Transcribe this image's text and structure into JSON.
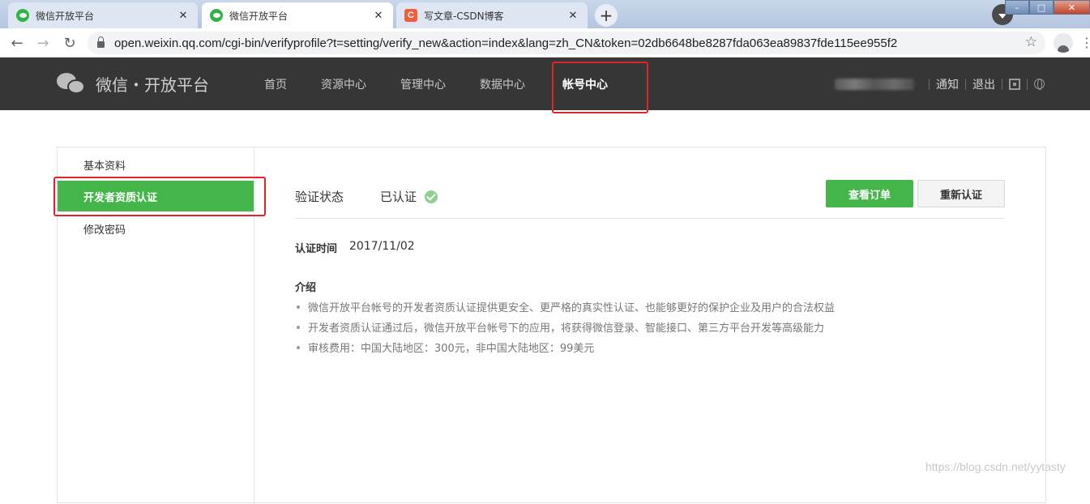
{
  "browser": {
    "tabs": [
      {
        "title": "微信开放平台",
        "icon": "wechat-icon",
        "state": "inactive"
      },
      {
        "title": "微信开放平台",
        "icon": "wechat-icon",
        "state": "active"
      },
      {
        "title": "写文章-CSDN博客",
        "icon": "csdn-icon",
        "state": "inactive",
        "icon_letter": "C"
      }
    ],
    "close_glyph": "✕",
    "new_tab_glyph": "+",
    "url": "open.weixin.qq.com/cgi-bin/verifyprofile?t=setting/verify_new&action=index&lang=zh_CN&token=02db6648be8287fda063ea89837fde115ee955f2",
    "back_glyph": "←",
    "forward_glyph": "→",
    "reload_glyph": "↻",
    "star_glyph": "☆",
    "menu_glyph": "⋮"
  },
  "header": {
    "logo_text": "微信・开放平台",
    "nav": [
      "首页",
      "资源中心",
      "管理中心",
      "数据中心",
      "帐号中心"
    ],
    "active_nav": "帐号中心",
    "notify": "通知",
    "logout": "退出"
  },
  "sidebar": {
    "items": [
      "基本资料",
      "开发者资质认证",
      "修改密码"
    ],
    "active_item": "开发者资质认证"
  },
  "main": {
    "status_label": "验证状态",
    "status_value": "已认证",
    "view_order_button": "查看订单",
    "reverify_button": "重新认证",
    "time_label": "认证时间",
    "time_value": "2017/11/02",
    "intro_title": "介绍",
    "intro_items": [
      "微信开放平台帐号的开发者资质认证提供更安全、更严格的真实性认证、也能够更好的保护企业及用户的合法权益",
      "开发者资质认证通过后，微信开放平台帐号下的应用，将获得微信登录、智能接口、第三方平台开发等高级能力",
      "审核费用：中国大陆地区：300元，非中国大陆地区：99美元"
    ]
  },
  "watermark": "https://blog.csdn.net/yytasty",
  "colors": {
    "accent_green": "#44b549",
    "header_bg": "#363636",
    "highlight_red": "#e0242b"
  }
}
